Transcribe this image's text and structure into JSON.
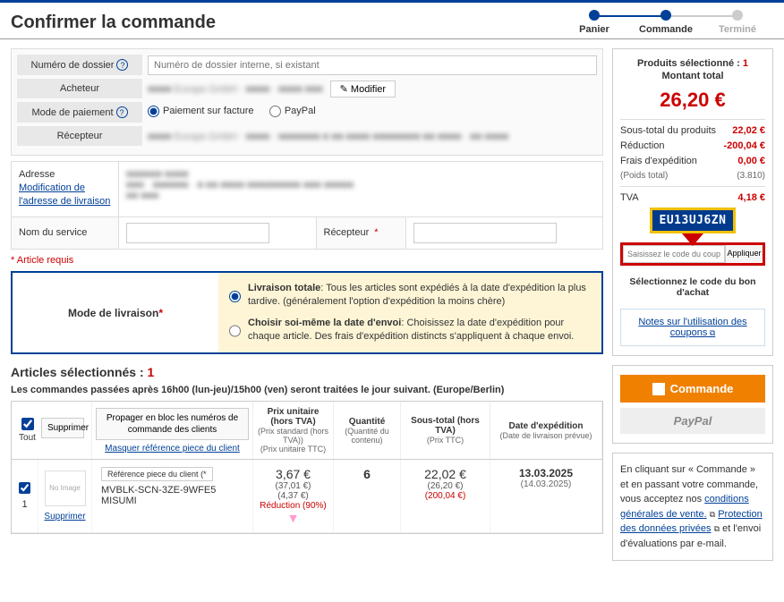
{
  "header": {
    "title": "Confirmer la commande"
  },
  "stepper": {
    "cart": "Panier",
    "order": "Commande",
    "done": "Terminé"
  },
  "form": {
    "dossier_label": "Numéro de dossier",
    "dossier_placeholder": "Numéro de dossier interne, si existant",
    "acheteur_label": "Acheteur",
    "modifier": "Modifier",
    "paiement_label": "Mode de paiement",
    "paiement_facture": "Paiement sur facture",
    "paiement_paypal": "PayPal",
    "recepteur_label": "Récepteur",
    "adresse_label": "Adresse",
    "adresse_link": "Modification de l'adresse de livraison",
    "service_label": "Nom du service",
    "recepteur2_label": "Récepteur"
  },
  "required_note": "* Article requis",
  "delivery": {
    "label": "Mode de livraison",
    "opt1_title": "Livraison totale",
    "opt1_desc": ": Tous les articles sont expédiés à la date d'expédition la plus tardive. (généralement l'option d'expédition la moins chère)",
    "opt2_title": "Choisir soi-même la date d'envoi",
    "opt2_desc": ": Choisissez la date d'expédition pour chaque article. Des frais d'expédition distincts s'appliquent à chaque envoi."
  },
  "items": {
    "title": "Articles sélectionnés :",
    "count": "1",
    "note": "Les commandes passées après 16h00 (lun-jeu)/15h00 (ven) seront traitées le jour suivant. (Europe/Berlin)",
    "th_tout": "Tout",
    "th_supprimer": "Supprimer",
    "th_propager": "Propager en bloc les numéros de commande des clients",
    "th_masquer": "Masquer référence piece du client",
    "th_prix": "Prix unitaire (hors TVA)",
    "th_prix_sub1": "(Prix standard (hors TVA))",
    "th_prix_sub2": "(Prix unitaire TTC)",
    "th_qty": "Quantité",
    "th_qty_sub": "(Quantité du contenu)",
    "th_sous": "Sous-total (hors TVA)",
    "th_sous_sub": "(Prix TTC)",
    "th_date": "Date d'expédition",
    "th_date_sub": "(Date de livraison prévue)",
    "row": {
      "num": "1",
      "noimg": "No Image",
      "ref_btn": "Référence piece du client (*",
      "sku": "MVBLK-SCN-3ZE-9WFE5",
      "brand": "MISUMI",
      "supprimer": "Supprimer",
      "price": "3,67 €",
      "price_std": "(37,01 €)",
      "price_ttc": "(4,37 €)",
      "reduc": "Réduction (90%)",
      "qty": "6",
      "sub": "22,02 €",
      "sub_ttc": "(26,20 €)",
      "sub_red": "(200,04 €)",
      "date": "13.03.2025",
      "date_sub": "(14.03.2025)"
    }
  },
  "summary": {
    "title_a": "Produits sélectionné :",
    "title_count": "1",
    "title_b": "Montant total",
    "total": "26,20 €",
    "subtotal_lbl": "Sous-total du produits",
    "subtotal_val": "22,02 €",
    "reduc_lbl": "Réduction",
    "reduc_val": "-200,04 €",
    "ship_lbl": "Frais d'expédition",
    "ship_val": "0,00 €",
    "weight_lbl": "(Poids total)",
    "weight_val": "(3.810)",
    "tva_lbl": "TVA",
    "tva_val": "4,18 €",
    "coupon_code": "EU13UJ6ZN",
    "coupon_placeholder": "Saisissez le code du coupon",
    "coupon_btn": "Appliquer",
    "select_bon": "Sélectionnez le code du bon d'achat",
    "notes": "Notes sur l'utilisation des coupons",
    "order_btn": "Commande",
    "paypal_btn": "PayPal",
    "legal_a": "En cliquant sur « Commande » et en passant votre commande, vous acceptez nos ",
    "legal_cgv": "conditions générales de vente.",
    "legal_priv": "Protection des données privées",
    "legal_b": " et l'envoi d'évaluations par e-mail."
  }
}
